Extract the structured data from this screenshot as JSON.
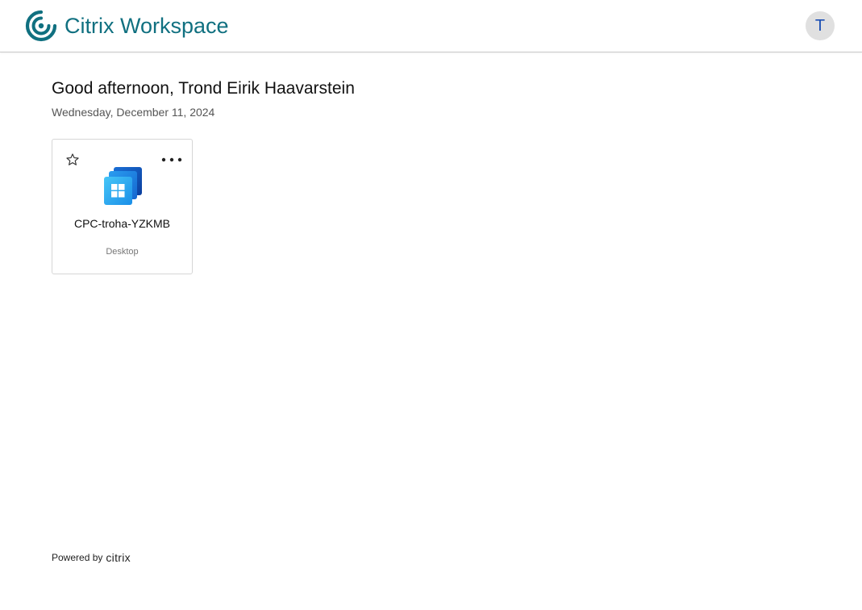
{
  "header": {
    "brand_name": "Citrix Workspace",
    "brand_color": "#107080",
    "logo_icon": "citrix-swirl-icon",
    "avatar_initial": "T"
  },
  "main": {
    "greeting": "Good afternoon, Trond Eirik Haavarstein",
    "date": "Wednesday, December 11, 2024",
    "resources": [
      {
        "name": "CPC-troha-YZKMB",
        "type": "Desktop",
        "icon": "windows-cloud-pc-icon",
        "favorite_icon": "star-outline-icon",
        "more_icon": "more-horizontal-icon"
      }
    ]
  },
  "footer": {
    "powered_by": "Powered by",
    "brand": "citrix"
  }
}
